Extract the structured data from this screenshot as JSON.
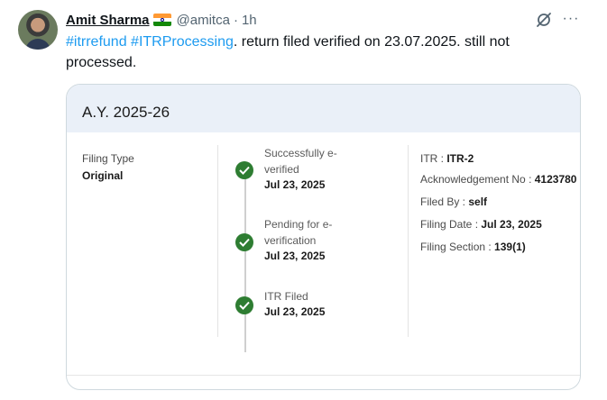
{
  "post": {
    "author_name": "Amit Sharma",
    "flag_icon": "india-flag-icon",
    "handle": "@amitca",
    "separator": "·",
    "time": "1h",
    "hashtags": [
      "#itrrefund",
      "#ITRProcessing"
    ],
    "text_rest": ". return filed verified on 23.07.2025. still not processed.",
    "more_label": "···"
  },
  "card": {
    "title": "A.Y. 2025-26",
    "filing_type_label": "Filing Type",
    "filing_type_value": "Original",
    "steps": [
      {
        "title": "Successfully e-verified",
        "date": "Jul 23, 2025"
      },
      {
        "title": "Pending for e-verification",
        "date": "Jul 23, 2025"
      },
      {
        "title": "ITR Filed",
        "date": "Jul 23, 2025"
      }
    ],
    "details": {
      "itr_label": "ITR :",
      "itr_value": "ITR-2",
      "ack_label": "Acknowledgement No :",
      "ack_value": "4123780",
      "filed_by_label": "Filed By :",
      "filed_by_value": "self",
      "filing_date_label": "Filing Date :",
      "filing_date_value": "Jul 23, 2025",
      "section_label": "Filing Section :",
      "section_value": "139(1)"
    }
  },
  "colors": {
    "link": "#1d9bf0",
    "check": "#2e7d32",
    "card_header_bg": "#eaf0f8"
  }
}
